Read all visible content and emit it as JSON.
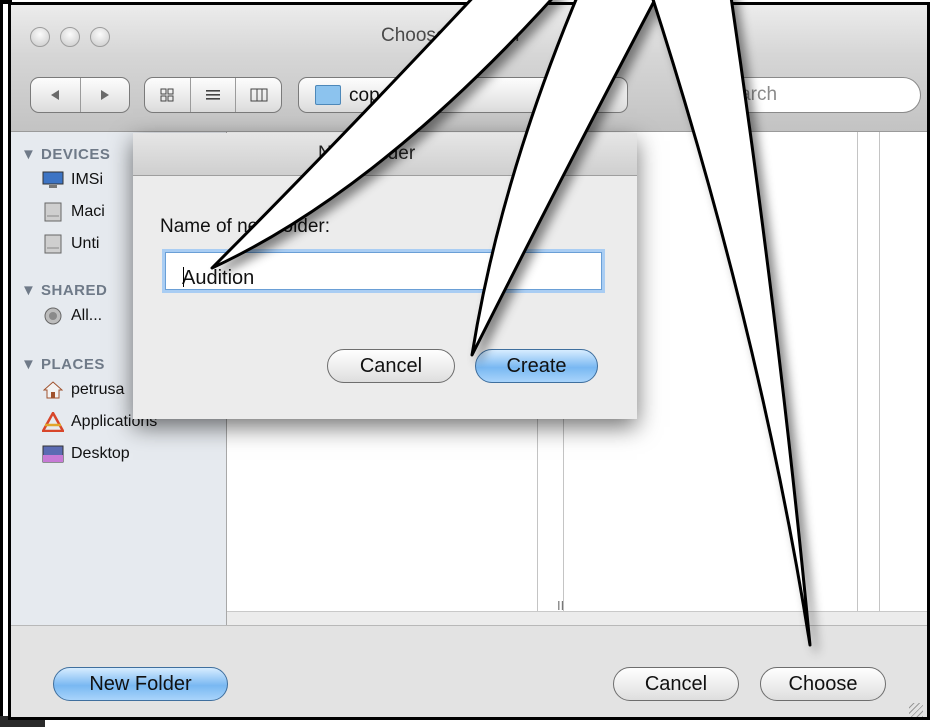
{
  "window": {
    "title": "Choose a Folder"
  },
  "toolbar": {
    "back_icon": "back-arrow-icon",
    "forward_icon": "forward-arrow-icon",
    "view_icons": [
      "icon-view-icon",
      "list-view-icon",
      "column-view-icon"
    ],
    "location_folder": "copenhagen",
    "search_placeholder": "search"
  },
  "sidebar": {
    "sections": [
      {
        "title": "DEVICES",
        "items": [
          {
            "label": "IMSi",
            "icon": "computer-icon"
          },
          {
            "label": "Maci",
            "icon": "hard-drive-icon"
          },
          {
            "label": "Unti",
            "icon": "hard-drive-icon"
          }
        ]
      },
      {
        "title": "SHARED",
        "items": [
          {
            "label": "All...",
            "icon": "network-icon"
          }
        ]
      },
      {
        "title": "PLACES",
        "items": [
          {
            "label": "petrusa",
            "icon": "home-icon"
          },
          {
            "label": "Applications",
            "icon": "applications-icon"
          },
          {
            "label": "Desktop",
            "icon": "desktop-icon"
          }
        ]
      }
    ]
  },
  "browser": {
    "column_grip": "II"
  },
  "dialog": {
    "title": "New Folder",
    "prompt": "Name of new folder:",
    "name_value": "Audition",
    "cancel_label": "Cancel",
    "create_label": "Create"
  },
  "footer": {
    "new_folder_label": "New Folder",
    "cancel_label": "Cancel",
    "choose_label": "Choose"
  },
  "colors": {
    "accent_blue": "#79b8f2",
    "sidebar_header": "#6f7a88",
    "focus_ring": "#a9cdf3"
  }
}
